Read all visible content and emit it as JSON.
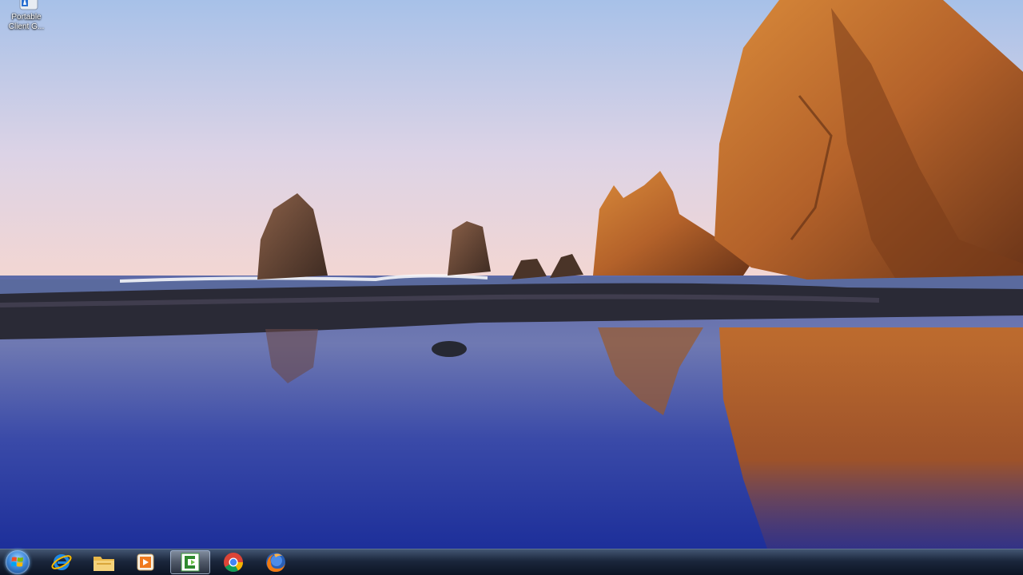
{
  "desktop": {
    "wallpaper": "beach-sea-stacks-sunset",
    "icons": [
      {
        "label": "Portable\nClient G...",
        "icon": "portable-client-icon"
      }
    ]
  },
  "taskbar": {
    "start_button": {
      "icon": "windows-orb-icon"
    },
    "pinned": [
      {
        "icon": "internet-explorer-icon",
        "active": false
      },
      {
        "icon": "file-explorer-folder-icon",
        "active": false
      },
      {
        "icon": "media-player-icon",
        "active": false
      },
      {
        "icon": "camtasia-icon",
        "active": true
      },
      {
        "icon": "chrome-icon",
        "active": false
      },
      {
        "icon": "firefox-icon",
        "active": false
      }
    ]
  },
  "colors": {
    "sky_top": "#aac3e8",
    "sky_horizon": "#f0d7d8",
    "water": "#2d3fa0",
    "rock": "#b9642a",
    "taskbar": "#1c283e"
  }
}
